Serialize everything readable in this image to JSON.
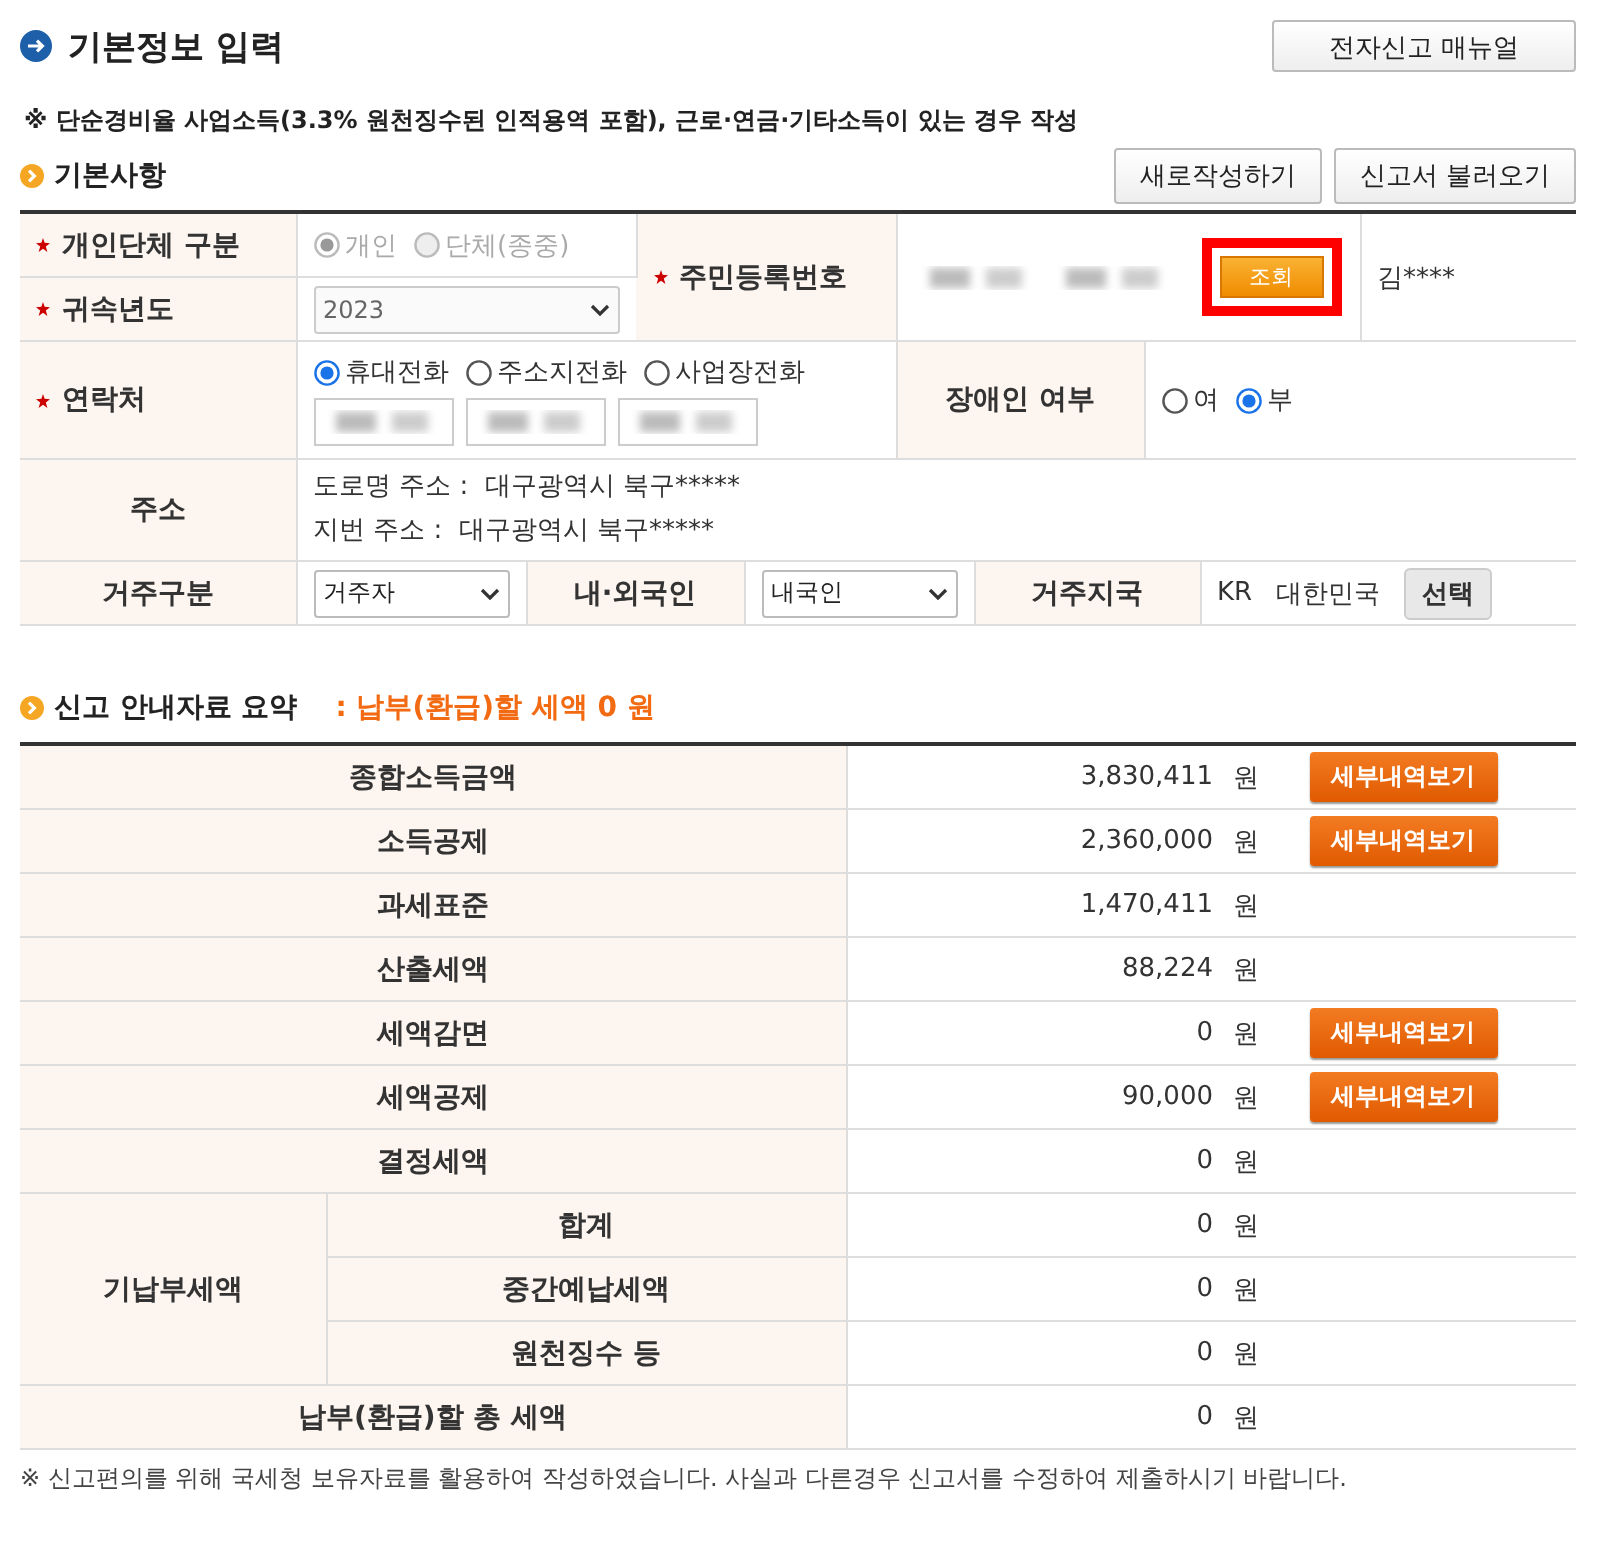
{
  "header": {
    "title": "기본정보 입력",
    "manual_button": "전자신고 매뉴얼"
  },
  "notice": "※ 단순경비율 사업소득(3.3% 원천징수된 인적용역 포함), 근로·연금·기타소득이 있는 경우 작성",
  "basic": {
    "title": "기본사항",
    "buttons": [
      "새로작성하기",
      "신고서 불러오기"
    ],
    "taxpayer_type": {
      "label": "개인단체 구분",
      "required": true,
      "disabled": true,
      "options": [
        {
          "label": "개인",
          "selected": true
        },
        {
          "label": "단체(종중)",
          "selected": false
        }
      ]
    },
    "year": {
      "label": "귀속년도",
      "required": true,
      "disabled": true,
      "value": "2023"
    },
    "resident_id": {
      "label": "주민등록번호",
      "required": true,
      "lookup_button": "조회",
      "highlighted": true,
      "name": "김****"
    },
    "contact": {
      "label": "연락처",
      "required": true,
      "options": [
        {
          "label": "휴대전화",
          "selected": true
        },
        {
          "label": "주소지전화",
          "selected": false
        },
        {
          "label": "사업장전화",
          "selected": false
        }
      ]
    },
    "disability": {
      "label": "장애인 여부",
      "options": [
        {
          "label": "여",
          "selected": false
        },
        {
          "label": "부",
          "selected": true
        }
      ]
    },
    "address": {
      "label": "주소",
      "lines": [
        "도로명 주소 :  대구광역시 북구*****",
        "지번 주소 :  대구광역시 북구*****"
      ]
    },
    "residence_type": {
      "label": "거주구분",
      "value": "거주자"
    },
    "nationality": {
      "label": "내·외국인",
      "value": "내국인"
    },
    "country": {
      "label": "거주지국",
      "code": "KR",
      "name": "대한민국",
      "button": "선택"
    }
  },
  "summary": {
    "title": "신고 안내자료 요약",
    "total": ": 납부(환급)할 세액 0 원",
    "rows": [
      {
        "kind": "single",
        "label": "종합소득금액",
        "amount": "3,830,411",
        "unit": "원",
        "detail_button": "세부내역보기"
      },
      {
        "kind": "single",
        "label": "소득공제",
        "amount": "2,360,000",
        "unit": "원",
        "detail_button": "세부내역보기"
      },
      {
        "kind": "single",
        "label": "과세표준",
        "amount": "1,470,411",
        "unit": "원"
      },
      {
        "kind": "single",
        "label": "산출세액",
        "amount": "88,224",
        "unit": "원"
      },
      {
        "kind": "single",
        "label": "세액감면",
        "amount": "0",
        "unit": "원",
        "detail_button": "세부내역보기"
      },
      {
        "kind": "single",
        "label": "세액공제",
        "amount": "90,000",
        "unit": "원",
        "detail_button": "세부내역보기"
      },
      {
        "kind": "single",
        "label": "결정세액",
        "amount": "0",
        "unit": "원"
      },
      {
        "kind": "group",
        "label": "기납부세액",
        "children": [
          {
            "label": "합계",
            "amount": "0",
            "unit": "원"
          },
          {
            "label": "중간예납세액",
            "amount": "0",
            "unit": "원"
          },
          {
            "label": "원천징수 등",
            "amount": "0",
            "unit": "원"
          }
        ]
      },
      {
        "kind": "single",
        "label": "납부(환급)할 총 세액",
        "amount": "0",
        "unit": "원"
      }
    ]
  },
  "footer_note": "※ 신고편의를 위해 국세청 보유자료를 활용하여 작성하였습니다. 사실과 다른경우 신고서를 수정하여 제출하시기 바랍니다."
}
